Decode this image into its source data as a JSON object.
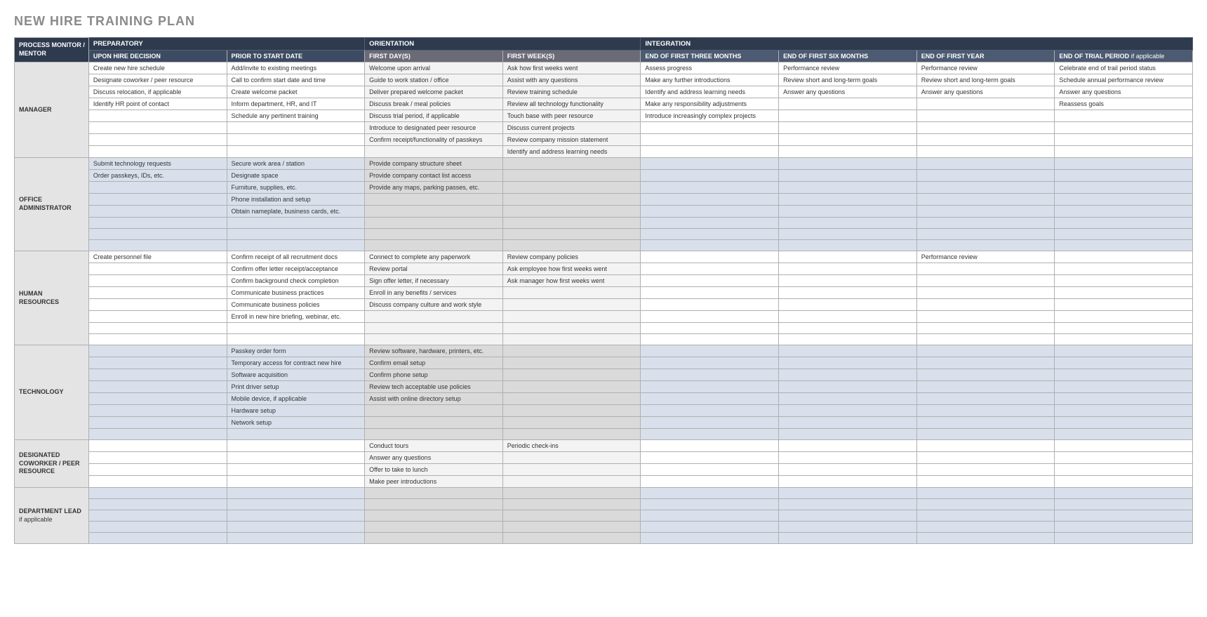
{
  "title": "NEW HIRE TRAINING PLAN",
  "headers": {
    "role": "PROCESS MONITOR / MENTOR",
    "top": [
      "PREPARATORY",
      "ORIENTATION",
      "INTEGRATION"
    ],
    "sub": [
      "UPON HIRE DECISION",
      "PRIOR TO START DATE",
      "FIRST DAY(S)",
      "FIRST WEEK(S)",
      "END OF FIRST THREE MONTHS",
      "END OF FIRST SIX MONTHS",
      "END OF FIRST YEAR",
      "END OF TRIAL PERIOD"
    ],
    "sub_suffix": " if applicable"
  },
  "sections": [
    {
      "role": "MANAGER",
      "rows": [
        [
          "Create new hire schedule",
          "Add/invite to existing meetings",
          "Welcome upon arrival",
          "Ask how first weeks went",
          "Assess progress",
          "Performance review",
          "Performance review",
          "Celebrate end of trail period status"
        ],
        [
          "Designate coworker / peer resource",
          "Call to confirm start date and time",
          "Guide to work station / office",
          "Assist with any questions",
          "Make any further introductions",
          "Review short and long-term goals",
          "Review short and long-term goals",
          "Schedule annual performance review"
        ],
        [
          "Discuss relocation, if applicable",
          "Create welcome packet",
          "Deliver prepared welcome packet",
          "Review training schedule",
          "Identify and address learning needs",
          "Answer any questions",
          "Answer any questions",
          "Answer any questions"
        ],
        [
          "Identify HR point of contact",
          "Inform department, HR, and IT",
          "Discuss break / meal policies",
          "Review all technology functionality",
          "Make any responsibility adjustments",
          "",
          "",
          "Reassess goals"
        ],
        [
          "",
          "Schedule any pertinent training",
          "Discuss trial period, if applicable",
          "Touch base with peer resource",
          "Introduce increasingly complex projects",
          "",
          "",
          ""
        ],
        [
          "",
          "",
          "Introduce to designated peer resource",
          "Discuss current projects",
          "",
          "",
          "",
          ""
        ],
        [
          "",
          "",
          "Confirm receipt/functionality of passkeys",
          "Review company mission statement",
          "",
          "",
          "",
          ""
        ],
        [
          "",
          "",
          "",
          "Identify and address learning needs",
          "",
          "",
          "",
          ""
        ]
      ]
    },
    {
      "role": "OFFICE ADMINISTRATOR",
      "rows": [
        [
          "Submit technology requests",
          "Secure work area / station",
          "Provide company structure sheet",
          "",
          "",
          "",
          "",
          ""
        ],
        [
          "Order passkeys, IDs, etc.",
          "Designate space",
          "Provide company contact list access",
          "",
          "",
          "",
          "",
          ""
        ],
        [
          "",
          "Furniture, supplies, etc.",
          "Provide any maps, parking passes, etc.",
          "",
          "",
          "",
          "",
          ""
        ],
        [
          "",
          "Phone installation and setup",
          "",
          "",
          "",
          "",
          "",
          ""
        ],
        [
          "",
          "Obtain nameplate, business cards, etc.",
          "",
          "",
          "",
          "",
          "",
          ""
        ],
        [
          "",
          "",
          "",
          "",
          "",
          "",
          "",
          ""
        ],
        [
          "",
          "",
          "",
          "",
          "",
          "",
          "",
          ""
        ],
        [
          "",
          "",
          "",
          "",
          "",
          "",
          "",
          ""
        ]
      ]
    },
    {
      "role": "HUMAN RESOURCES",
      "rows": [
        [
          "Create personnel file",
          "Confirm receipt of all recruitment docs",
          "Connect to complete any paperwork",
          "Review company policies",
          "",
          "",
          "Performance review",
          ""
        ],
        [
          "",
          "Confirm offer letter receipt/acceptance",
          "Review portal",
          "Ask employee how first weeks went",
          "",
          "",
          "",
          ""
        ],
        [
          "",
          "Confirm background check completion",
          "Sign offer letter, if necessary",
          "Ask manager how first weeks went",
          "",
          "",
          "",
          ""
        ],
        [
          "",
          "Communicate business practices",
          "Enroll in any benefits / services",
          "",
          "",
          "",
          "",
          ""
        ],
        [
          "",
          "Communicate business policies",
          "Discuss company culture and work style",
          "",
          "",
          "",
          "",
          ""
        ],
        [
          "",
          "Enroll in new hire briefing, webinar, etc.",
          "",
          "",
          "",
          "",
          "",
          ""
        ],
        [
          "",
          "",
          "",
          "",
          "",
          "",
          "",
          ""
        ],
        [
          "",
          "",
          "",
          "",
          "",
          "",
          "",
          ""
        ]
      ]
    },
    {
      "role": "TECHNOLOGY",
      "rows": [
        [
          "",
          "Passkey order form",
          "Review software, hardware, printers, etc.",
          "",
          "",
          "",
          "",
          ""
        ],
        [
          "",
          "Temporary access for contract new hire",
          "Confirm email setup",
          "",
          "",
          "",
          "",
          ""
        ],
        [
          "",
          "Software acquisition",
          "Confirm phone setup",
          "",
          "",
          "",
          "",
          ""
        ],
        [
          "",
          "Print driver setup",
          "Review tech acceptable use policies",
          "",
          "",
          "",
          "",
          ""
        ],
        [
          "",
          "Mobile device, if applicable",
          "Assist with online directory setup",
          "",
          "",
          "",
          "",
          ""
        ],
        [
          "",
          "Hardware setup",
          "",
          "",
          "",
          "",
          "",
          ""
        ],
        [
          "",
          "Network setup",
          "",
          "",
          "",
          "",
          "",
          ""
        ],
        [
          "",
          "",
          "",
          "",
          "",
          "",
          "",
          ""
        ]
      ]
    },
    {
      "role": "DESIGNATED COWORKER / PEER RESOURCE",
      "rows": [
        [
          "",
          "",
          "Conduct tours",
          "Periodic check-ins",
          "",
          "",
          "",
          ""
        ],
        [
          "",
          "",
          "Answer any questions",
          "",
          "",
          "",
          "",
          ""
        ],
        [
          "",
          "",
          "Offer to take to lunch",
          "",
          "",
          "",
          "",
          ""
        ],
        [
          "",
          "",
          "Make peer introductions",
          "",
          "",
          "",
          "",
          ""
        ]
      ]
    },
    {
      "role": "DEPARTMENT LEAD",
      "role_sub": "if applicable",
      "rows": [
        [
          "",
          "",
          "",
          "",
          "",
          "",
          "",
          ""
        ],
        [
          "",
          "",
          "",
          "",
          "",
          "",
          "",
          ""
        ],
        [
          "",
          "",
          "",
          "",
          "",
          "",
          "",
          ""
        ],
        [
          "",
          "",
          "",
          "",
          "",
          "",
          "",
          ""
        ],
        [
          "",
          "",
          "",
          "",
          "",
          "",
          "",
          ""
        ]
      ]
    }
  ]
}
